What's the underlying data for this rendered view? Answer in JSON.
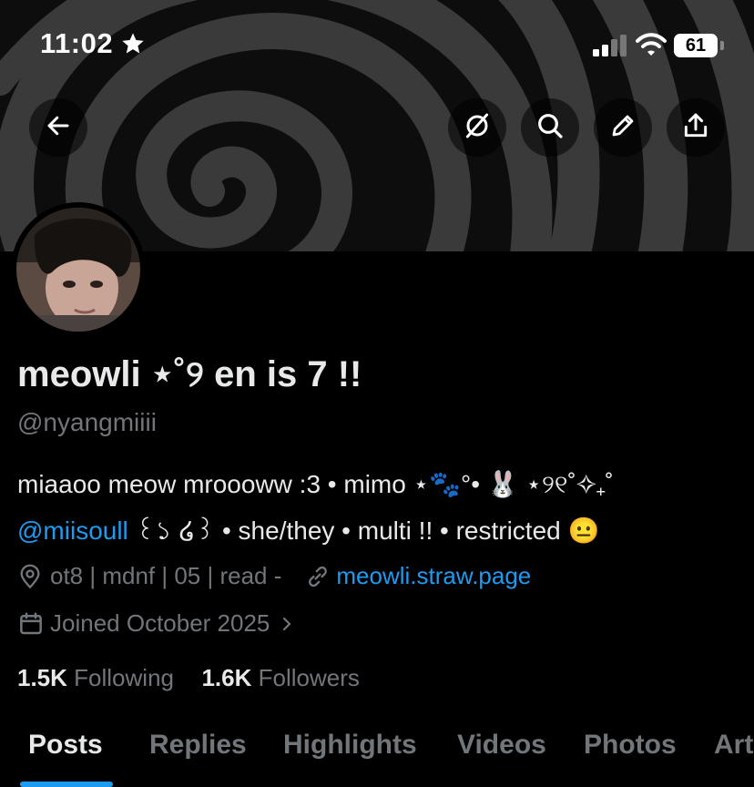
{
  "status_bar": {
    "time": "11:02",
    "battery": "61"
  },
  "profile": {
    "display_name": "meowli ⋆˚୨ en is 7 !!",
    "handle": "@nyangmiiii",
    "bio_line1": "miaaoo meow mroooww :3 • mimo ⋆🐾°• 🐰 ⋆୨୧˚✧₊˚",
    "bio_mention": "@miisoull",
    "bio_line2_rest": " ꒰১ ໒꒱ • she/they • multi !! • restricted 😐",
    "location": "ot8 | mdnf | 05 | read -",
    "website": "meowli.straw.page",
    "joined": "Joined October 2025",
    "following_count": "1.5K",
    "following_label": "Following",
    "followers_count": "1.6K",
    "followers_label": "Followers"
  },
  "tabs": [
    "Posts",
    "Replies",
    "Highlights",
    "Videos",
    "Photos",
    "Art"
  ],
  "active_tab": "Posts",
  "icons": {
    "back": "back-arrow-icon",
    "grok": "grok-icon",
    "search": "search-icon",
    "edit": "pencil-icon",
    "share": "share-icon",
    "location": "location-pin-icon",
    "link": "link-icon",
    "calendar": "calendar-icon",
    "chevron": "chevron-right-icon"
  },
  "colors": {
    "accent": "#1d9bf0",
    "muted": "#71767b",
    "text": "#e7e9ea",
    "background": "#000000"
  }
}
